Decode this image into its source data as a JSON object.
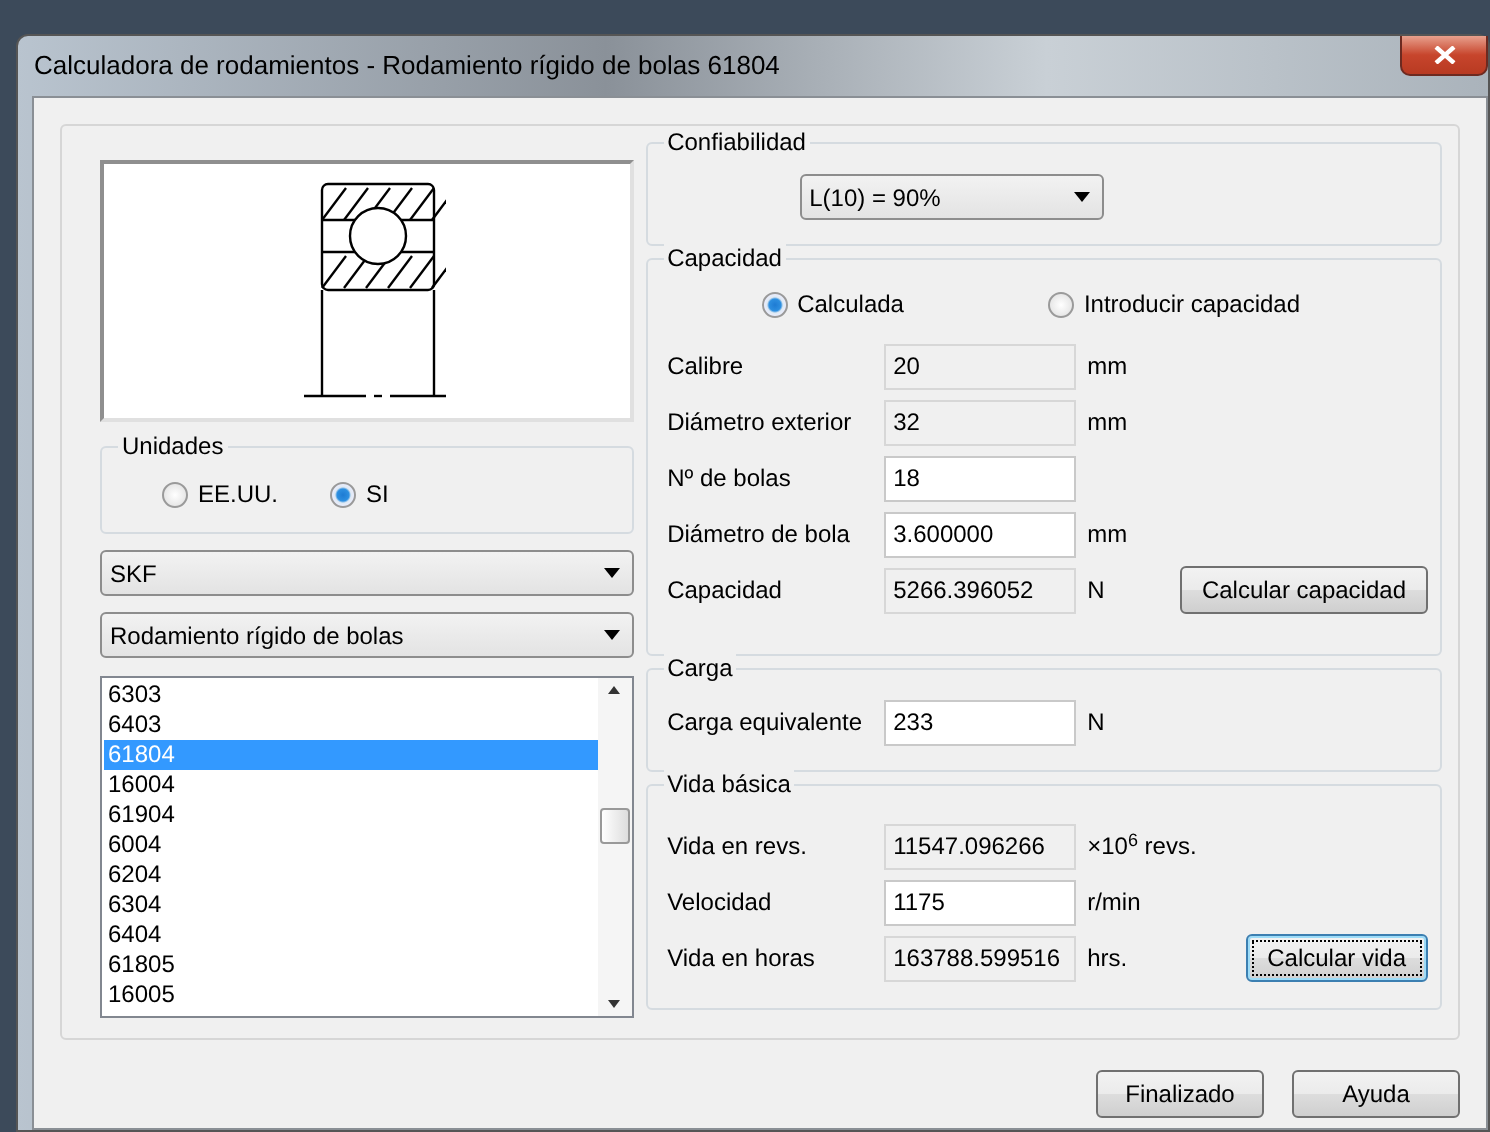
{
  "window": {
    "title": "Calculadora de rodamientos - Rodamiento rígido de bolas 61804"
  },
  "units": {
    "label": "Unidades",
    "options": [
      {
        "label": "EE.UU.",
        "selected": false
      },
      {
        "label": "SI",
        "selected": true
      }
    ]
  },
  "manufacturer": {
    "value": "SKF"
  },
  "bearing_type": {
    "value": "Rodamiento rígido de bolas"
  },
  "bearing_list": [
    {
      "label": "6303",
      "selected": false
    },
    {
      "label": "6403",
      "selected": false
    },
    {
      "label": "61804",
      "selected": true
    },
    {
      "label": "16004",
      "selected": false
    },
    {
      "label": "61904",
      "selected": false
    },
    {
      "label": "6004",
      "selected": false
    },
    {
      "label": "6204",
      "selected": false
    },
    {
      "label": "6304",
      "selected": false
    },
    {
      "label": "6404",
      "selected": false
    },
    {
      "label": "61805",
      "selected": false
    },
    {
      "label": "16005",
      "selected": false
    }
  ],
  "reliability": {
    "label": "Confiabilidad",
    "value": "L(10) = 90%"
  },
  "capacity": {
    "label": "Capacidad",
    "modes": [
      {
        "label": "Calculada",
        "selected": true
      },
      {
        "label": "Introducir capacidad",
        "selected": false
      }
    ],
    "fields": [
      {
        "label": "Calibre",
        "value": "20",
        "unit": "mm",
        "readonly": true
      },
      {
        "label": "Diámetro exterior",
        "value": "32",
        "unit": "mm",
        "readonly": true
      },
      {
        "label": "Nº de bolas",
        "value": "18",
        "readonly": false
      },
      {
        "label": "Diámetro de bola",
        "value": "3.600000",
        "unit": "mm",
        "readonly": false
      },
      {
        "label": "Capacidad",
        "value": "5266.396052",
        "unit": "N",
        "readonly": true
      }
    ],
    "button": {
      "label": "Calcular capacidad",
      "focused": false
    }
  },
  "load": {
    "label": "Carga",
    "fields": [
      {
        "label": "Carga equivalente",
        "value": "233",
        "unit": "N",
        "readonly": false
      }
    ]
  },
  "basic_life": {
    "label": "Vida básica",
    "fields": [
      {
        "label": "Vida en revs.",
        "value": "11547.096266",
        "unit": "×10$^{6}$  revs.",
        "readonly": true
      },
      {
        "label": "Velocidad",
        "value": "1175",
        "unit": "r/min",
        "readonly": false
      },
      {
        "label": "Vida en horas",
        "value": "163788.599516",
        "unit": "hrs.",
        "readonly": true
      }
    ],
    "button": {
      "label": "Calcular vida",
      "focused": true
    }
  },
  "buttons": [
    "Finalizado",
    "Ayuda"
  ]
}
